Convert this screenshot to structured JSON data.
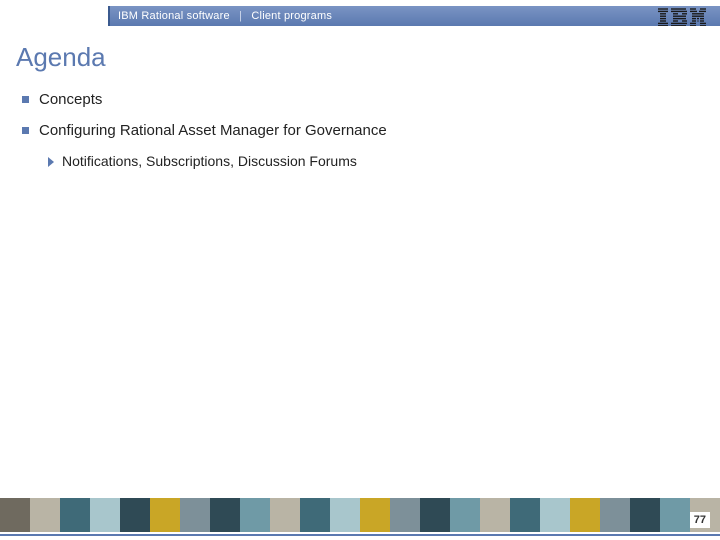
{
  "header": {
    "brand": "IBM Rational software",
    "section": "Client programs",
    "separator": "|"
  },
  "title": "Agenda",
  "bullets": [
    {
      "text": "Concepts",
      "children": []
    },
    {
      "text": "Configuring Rational Asset Manager for Governance",
      "children": [
        {
          "text": "Notifications, Subscriptions, Discussion Forums"
        }
      ]
    }
  ],
  "footer": {
    "page_number": "77",
    "tiles": [
      "#6f6a5f",
      "#b9b4a5",
      "#3f6a78",
      "#a8c6cc",
      "#2f4a55",
      "#c9a626",
      "#7d9099",
      "#2f4a55",
      "#6f9aa6",
      "#b9b4a5",
      "#3f6a78",
      "#a8c6cc",
      "#c9a626",
      "#7d9099",
      "#2f4a55",
      "#6f9aa6",
      "#b9b4a5",
      "#3f6a78",
      "#a8c6cc",
      "#c9a626",
      "#7d9099",
      "#2f4a55",
      "#6f9aa6",
      "#b9b4a5"
    ]
  },
  "colors": {
    "accent": "#5b79b0"
  }
}
